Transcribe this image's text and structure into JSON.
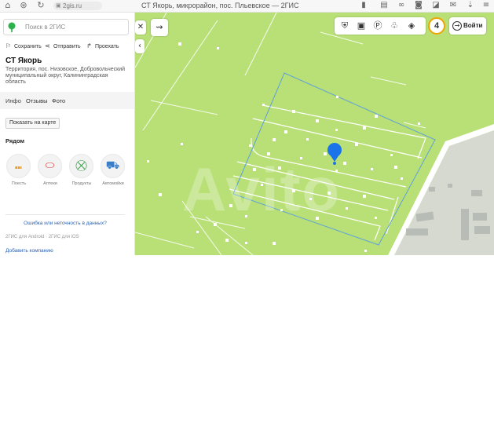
{
  "browser": {
    "url": "2gis.ru",
    "tab_title": "СТ Якорь, микрорайон, пос. Пльевское — 2ГИС"
  },
  "sidebar": {
    "search_placeholder": "Поиск в 2ГИС",
    "actions": {
      "save": "Сохранить",
      "send": "Отправить",
      "route": "Проехать"
    },
    "place_title": "СТ Якорь",
    "address": "Территория, пос. Низовское, Добровольческий муниципальный округ, Калининградская область",
    "tabs": [
      "Инфо",
      "Отзывы",
      "Фото"
    ],
    "show_on_map": "Показать на карте",
    "nearby_title": "Рядом",
    "nearby": [
      {
        "label": "Поесть",
        "icon": "fork-knife-icon",
        "color": "#e69c2a"
      },
      {
        "label": "Аптеки",
        "icon": "pill-icon",
        "color": "#d83c3c"
      },
      {
        "label": "Продукты",
        "icon": "basket-icon",
        "color": "#3aa14a"
      },
      {
        "label": "Автомойки",
        "icon": "car-wash-icon",
        "color": "#3a7ec8"
      }
    ],
    "info_link": "Ошибка или неточность в данных?",
    "footer": "2ГИС для Android · 2ГИС для iOS",
    "add_company": "Добавить компанию"
  },
  "map": {
    "zoom_badge": "4",
    "login": "Войти",
    "watermark": "Avito",
    "toolbar_icons": [
      "poi-icon",
      "bus-icon",
      "parking-icon",
      "tree-icon",
      "layers-icon"
    ],
    "colors": {
      "land": "#b9e077",
      "parcel_border": "#5ea0d8",
      "marker": "#1a73e8",
      "built_area": "#d5d9d0"
    }
  }
}
